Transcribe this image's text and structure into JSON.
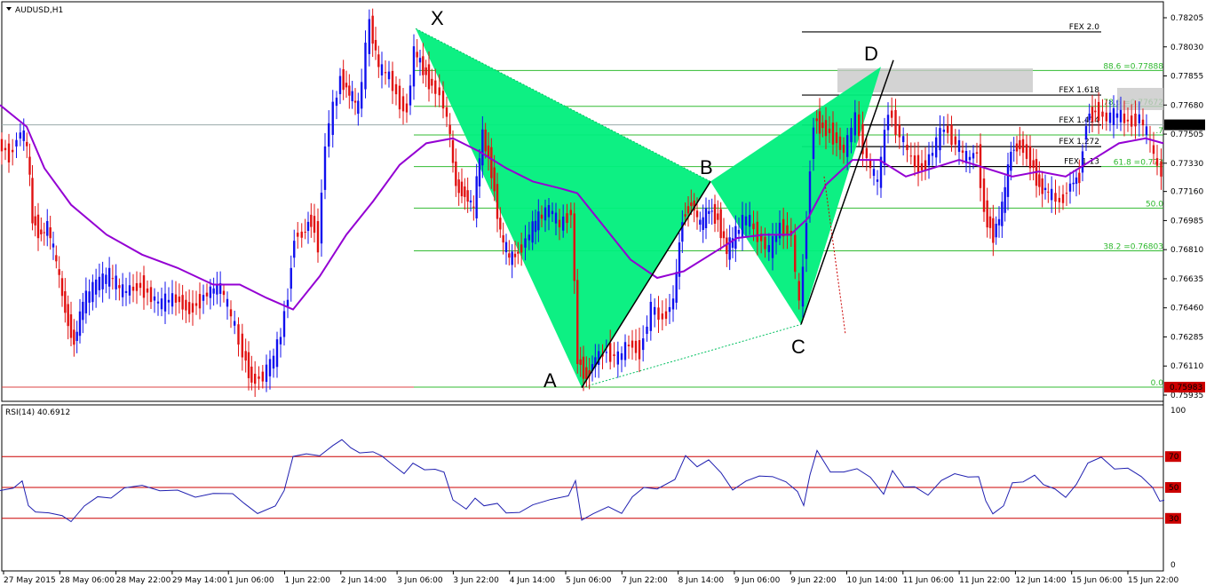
{
  "window": {
    "title": "AUDUSD,H1",
    "rsi_title": "RSI(14) 40.6912"
  },
  "colors": {
    "bull": "#1010ee",
    "bear": "#e01010",
    "ma": "#9400d3",
    "pattern": "#00ef7c",
    "fib": "#33bb33",
    "rsi": "#1f1fb0",
    "rsi_level": "#cc0000",
    "price_box": "#cc0000"
  },
  "main_axis": {
    "ticks": [
      "0.78205",
      "0.78030",
      "0.77855",
      "0.77680",
      "0.77505",
      "0.77330",
      "0.77160",
      "0.76985",
      "0.76810",
      "0.76635",
      "0.76460",
      "0.76285",
      "0.76110",
      "0.75935"
    ],
    "min": 0.75935,
    "max": 0.78205
  },
  "price_tags": {
    "current": "0.77561",
    "low": "0.75983"
  },
  "pattern_points": [
    {
      "name": "X",
      "price": 0.7814
    },
    {
      "name": "A",
      "price": 0.7598
    },
    {
      "name": "B",
      "price": 0.7722
    },
    {
      "name": "C",
      "price": 0.7636
    },
    {
      "name": "D",
      "price": 0.7791
    }
  ],
  "fib_levels": [
    {
      "label": "88.6 =0.77888",
      "price": 0.77888
    },
    {
      "label": "78.6 =0.77672",
      "price": 0.77672
    },
    {
      "label": ".7",
      "price": 0.775
    },
    {
      "label": "61.8 =0.773",
      "price": 0.7731
    },
    {
      "label": "50.0",
      "price": 0.7706
    },
    {
      "label": "38.2 =0.76803",
      "price": 0.76803
    },
    {
      "label": "0.0",
      "price": 0.75983
    }
  ],
  "fex_levels": [
    {
      "label": "FEX 2.0",
      "price": 0.7812
    },
    {
      "label": "FEX 1.618",
      "price": 0.7774
    },
    {
      "label": "FEX 1.414",
      "price": 0.7756
    },
    {
      "label": "FEX 1.272",
      "price": 0.7743
    },
    {
      "label": "FEX 1.13",
      "price": 0.7731
    }
  ],
  "rsi_axis": {
    "ticks": [
      "100",
      "70",
      "50",
      "30",
      "0"
    ],
    "levels": [
      70,
      50,
      30
    ]
  },
  "time_axis": [
    "27 May 2015",
    "28 May 06:00",
    "28 May 22:00",
    "29 May 14:00",
    "1 Jun 06:00",
    "1 Jun 22:00",
    "2 Jun 14:00",
    "3 Jun 06:00",
    "3 Jun 22:00",
    "4 Jun 14:00",
    "5 Jun 06:00",
    "7 Jun 22:00",
    "8 Jun 14:00",
    "9 Jun 06:00",
    "9 Jun 22:00",
    "10 Jun 14:00",
    "11 Jun 06:00",
    "11 Jun 22:00",
    "12 Jun 14:00",
    "15 Jun 06:00",
    "15 Jun 22:00"
  ],
  "price_path": [
    [
      0,
      0.7745
    ],
    [
      12,
      0.7738
    ],
    [
      25,
      0.7752
    ],
    [
      32,
      0.7742
    ],
    [
      38,
      0.77
    ],
    [
      48,
      0.769
    ],
    [
      55,
      0.7695
    ],
    [
      65,
      0.7672
    ],
    [
      75,
      0.7645
    ],
    [
      85,
      0.7625
    ],
    [
      95,
      0.7648
    ],
    [
      110,
      0.766
    ],
    [
      125,
      0.7665
    ],
    [
      140,
      0.7655
    ],
    [
      160,
      0.766
    ],
    [
      180,
      0.7648
    ],
    [
      200,
      0.7652
    ],
    [
      215,
      0.7645
    ],
    [
      235,
      0.7655
    ],
    [
      250,
      0.7658
    ],
    [
      262,
      0.764
    ],
    [
      275,
      0.762
    ],
    [
      285,
      0.7603
    ],
    [
      298,
      0.7605
    ],
    [
      310,
      0.7615
    ],
    [
      318,
      0.763
    ],
    [
      326,
      0.7655
    ],
    [
      333,
      0.769
    ],
    [
      342,
      0.769
    ],
    [
      352,
      0.77
    ],
    [
      360,
      0.7685
    ],
    [
      368,
      0.7745
    ],
    [
      377,
      0.7765
    ],
    [
      385,
      0.7785
    ],
    [
      395,
      0.7775
    ],
    [
      405,
      0.7765
    ],
    [
      418,
      0.7818
    ],
    [
      428,
      0.779
    ],
    [
      440,
      0.7785
    ],
    [
      452,
      0.777
    ],
    [
      460,
      0.7765
    ],
    [
      468,
      0.78
    ],
    [
      478,
      0.779
    ],
    [
      488,
      0.778
    ],
    [
      497,
      0.7775
    ],
    [
      505,
      0.776
    ],
    [
      515,
      0.772
    ],
    [
      525,
      0.7715
    ],
    [
      535,
      0.7705
    ],
    [
      545,
      0.775
    ],
    [
      555,
      0.773
    ],
    [
      565,
      0.769
    ],
    [
      575,
      0.7675
    ],
    [
      585,
      0.768
    ],
    [
      598,
      0.769
    ],
    [
      608,
      0.77
    ],
    [
      620,
      0.7705
    ],
    [
      632,
      0.7695
    ],
    [
      645,
      0.7705
    ],
    [
      652,
      0.7615
    ],
    [
      662,
      0.7605
    ],
    [
      672,
      0.7615
    ],
    [
      685,
      0.762
    ],
    [
      698,
      0.7615
    ],
    [
      710,
      0.7625
    ],
    [
      722,
      0.762
    ],
    [
      735,
      0.7645
    ],
    [
      748,
      0.764
    ],
    [
      760,
      0.765
    ],
    [
      770,
      0.77
    ],
    [
      780,
      0.771
    ],
    [
      790,
      0.7695
    ],
    [
      800,
      0.7705
    ],
    [
      810,
      0.77
    ],
    [
      820,
      0.768
    ],
    [
      830,
      0.769
    ],
    [
      842,
      0.77
    ],
    [
      855,
      0.769
    ],
    [
      868,
      0.768
    ],
    [
      880,
      0.7695
    ],
    [
      893,
      0.769
    ],
    [
      902,
      0.7645
    ],
    [
      910,
      0.77
    ],
    [
      918,
      0.776
    ],
    [
      928,
      0.7755
    ],
    [
      940,
      0.775
    ],
    [
      952,
      0.774
    ],
    [
      965,
      0.776
    ],
    [
      978,
      0.7735
    ],
    [
      990,
      0.772
    ],
    [
      1002,
      0.7765
    ],
    [
      1015,
      0.775
    ],
    [
      1028,
      0.7735
    ],
    [
      1040,
      0.773
    ],
    [
      1052,
      0.774
    ],
    [
      1065,
      0.7755
    ],
    [
      1078,
      0.7745
    ],
    [
      1090,
      0.7735
    ],
    [
      1102,
      0.774
    ],
    [
      1110,
      0.7705
    ],
    [
      1120,
      0.769
    ],
    [
      1130,
      0.7705
    ],
    [
      1140,
      0.774
    ],
    [
      1150,
      0.7745
    ],
    [
      1162,
      0.7735
    ],
    [
      1172,
      0.772
    ],
    [
      1182,
      0.7715
    ],
    [
      1195,
      0.771
    ],
    [
      1207,
      0.772
    ],
    [
      1217,
      0.7725
    ],
    [
      1225,
      0.776
    ],
    [
      1235,
      0.7765
    ],
    [
      1248,
      0.776
    ],
    [
      1260,
      0.7762
    ],
    [
      1272,
      0.7758
    ],
    [
      1285,
      0.776
    ],
    [
      1297,
      0.7745
    ],
    [
      1305,
      0.773
    ],
    [
      1310,
      0.7729
    ]
  ],
  "ma_path": [
    [
      0,
      0.7768
    ],
    [
      30,
      0.7755
    ],
    [
      50,
      0.773
    ],
    [
      80,
      0.7708
    ],
    [
      120,
      0.769
    ],
    [
      160,
      0.7678
    ],
    [
      200,
      0.767
    ],
    [
      240,
      0.766
    ],
    [
      270,
      0.766
    ],
    [
      300,
      0.7652
    ],
    [
      330,
      0.7645
    ],
    [
      360,
      0.7665
    ],
    [
      390,
      0.769
    ],
    [
      420,
      0.771
    ],
    [
      450,
      0.7732
    ],
    [
      480,
      0.7745
    ],
    [
      510,
      0.7748
    ],
    [
      540,
      0.774
    ],
    [
      570,
      0.773
    ],
    [
      600,
      0.7722
    ],
    [
      630,
      0.7718
    ],
    [
      650,
      0.7715
    ],
    [
      680,
      0.7695
    ],
    [
      710,
      0.7675
    ],
    [
      740,
      0.7664
    ],
    [
      770,
      0.7668
    ],
    [
      800,
      0.7678
    ],
    [
      830,
      0.7688
    ],
    [
      860,
      0.769
    ],
    [
      890,
      0.769
    ],
    [
      910,
      0.77
    ],
    [
      930,
      0.772
    ],
    [
      960,
      0.7735
    ],
    [
      990,
      0.7735
    ],
    [
      1020,
      0.7725
    ],
    [
      1050,
      0.773
    ],
    [
      1080,
      0.7735
    ],
    [
      1110,
      0.773
    ],
    [
      1140,
      0.7725
    ],
    [
      1170,
      0.7728
    ],
    [
      1200,
      0.7725
    ],
    [
      1230,
      0.7735
    ],
    [
      1260,
      0.7745
    ],
    [
      1290,
      0.7748
    ],
    [
      1310,
      0.7745
    ]
  ],
  "rsi_path": [
    [
      0,
      48
    ],
    [
      15,
      50
    ],
    [
      25,
      55
    ],
    [
      32,
      40
    ],
    [
      40,
      33
    ],
    [
      55,
      35
    ],
    [
      70,
      30
    ],
    [
      80,
      26
    ],
    [
      95,
      40
    ],
    [
      110,
      42
    ],
    [
      125,
      45
    ],
    [
      140,
      48
    ],
    [
      160,
      50
    ],
    [
      180,
      47
    ],
    [
      200,
      48
    ],
    [
      220,
      44
    ],
    [
      240,
      47
    ],
    [
      262,
      44
    ],
    [
      275,
      38
    ],
    [
      290,
      35
    ],
    [
      310,
      40
    ],
    [
      320,
      50
    ],
    [
      330,
      72
    ],
    [
      345,
      70
    ],
    [
      360,
      72
    ],
    [
      375,
      76
    ],
    [
      385,
      80
    ],
    [
      395,
      75
    ],
    [
      405,
      72
    ],
    [
      420,
      73
    ],
    [
      430,
      70
    ],
    [
      440,
      65
    ],
    [
      455,
      60
    ],
    [
      465,
      67
    ],
    [
      478,
      62
    ],
    [
      490,
      60
    ],
    [
      500,
      58
    ],
    [
      510,
      40
    ],
    [
      525,
      38
    ],
    [
      535,
      45
    ],
    [
      545,
      40
    ],
    [
      560,
      38
    ],
    [
      570,
      32
    ],
    [
      585,
      35
    ],
    [
      600,
      38
    ],
    [
      620,
      42
    ],
    [
      640,
      45
    ],
    [
      648,
      55
    ],
    [
      655,
      28
    ],
    [
      668,
      33
    ],
    [
      685,
      36
    ],
    [
      700,
      35
    ],
    [
      712,
      42
    ],
    [
      725,
      48
    ],
    [
      740,
      51
    ],
    [
      760,
      57
    ],
    [
      772,
      70
    ],
    [
      785,
      62
    ],
    [
      798,
      66
    ],
    [
      812,
      60
    ],
    [
      825,
      48
    ],
    [
      840,
      54
    ],
    [
      855,
      58
    ],
    [
      870,
      56
    ],
    [
      885,
      55
    ],
    [
      898,
      48
    ],
    [
      905,
      40
    ],
    [
      912,
      60
    ],
    [
      920,
      72
    ],
    [
      935,
      62
    ],
    [
      950,
      58
    ],
    [
      965,
      64
    ],
    [
      980,
      55
    ],
    [
      995,
      47
    ],
    [
      1005,
      62
    ],
    [
      1018,
      52
    ],
    [
      1030,
      50
    ],
    [
      1045,
      45
    ],
    [
      1060,
      55
    ],
    [
      1075,
      58
    ],
    [
      1090,
      58
    ],
    [
      1102,
      55
    ],
    [
      1110,
      43
    ],
    [
      1118,
      32
    ],
    [
      1130,
      40
    ],
    [
      1140,
      55
    ],
    [
      1152,
      52
    ],
    [
      1165,
      56
    ],
    [
      1175,
      50
    ],
    [
      1188,
      47
    ],
    [
      1200,
      45
    ],
    [
      1212,
      52
    ],
    [
      1225,
      65
    ],
    [
      1240,
      70
    ],
    [
      1255,
      62
    ],
    [
      1270,
      62
    ],
    [
      1285,
      58
    ],
    [
      1298,
      50
    ],
    [
      1306,
      42
    ],
    [
      1311,
      41
    ]
  ]
}
